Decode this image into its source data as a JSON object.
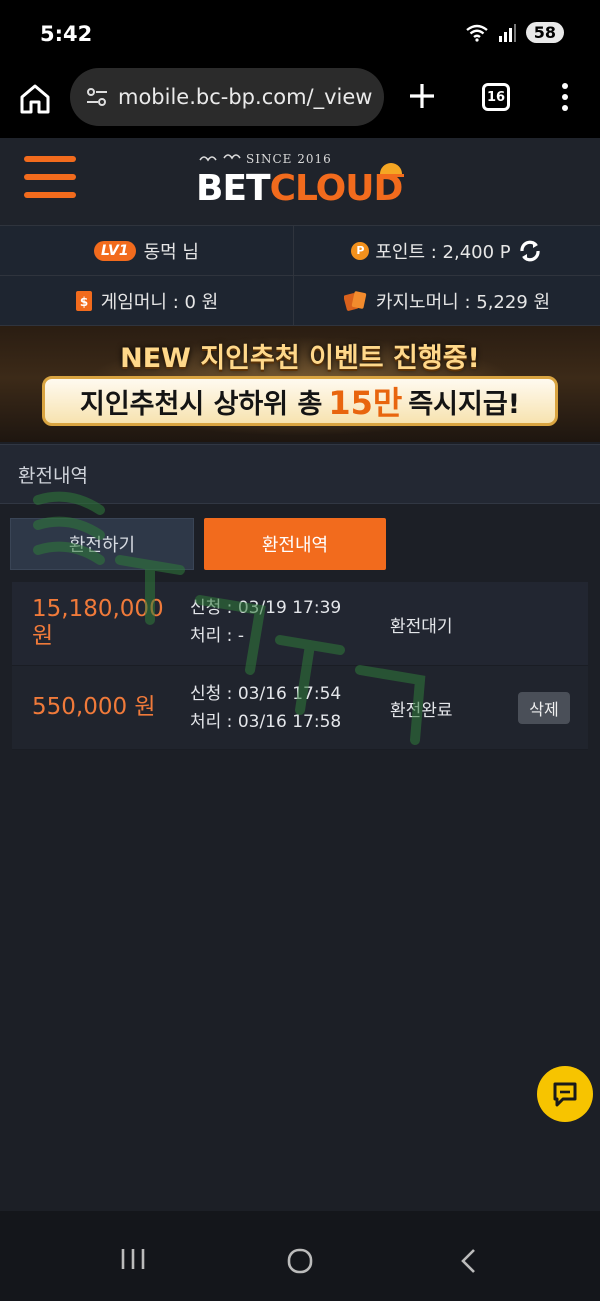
{
  "status": {
    "time": "5:42",
    "battery": "58"
  },
  "browser": {
    "url": "mobile.bc-bp.com/_view",
    "tab_count": "16"
  },
  "header": {
    "logo_since": "SINCE 2016",
    "logo_bet": "BET",
    "logo_cloud": "CLOUD"
  },
  "user": {
    "level": "LV1",
    "name": "동먹 님",
    "points": "포인트 : 2,400 P",
    "game_money": "게임머니 : 0 원",
    "casino_money": "카지노머니 : 5,229 원"
  },
  "banner": {
    "line1": "NEW 지인추천 이벤트 진행중!",
    "line2_pre": "지인추천시 상하위 총",
    "line2_highlight": "15만",
    "line2_post": "즉시지급!"
  },
  "section_title": "환전내역",
  "tabs": {
    "exchange": "환전하기",
    "history": "환전내역"
  },
  "records": [
    {
      "amount": "15,180,000 원",
      "request": "신청 : 03/19 17:39",
      "processed": "처리 : -",
      "status": "환전대기"
    },
    {
      "amount": "550,000 원",
      "request": "신청 : 03/16 17:54",
      "processed": "처리 : 03/16 17:58",
      "status": "환전완료",
      "delete_label": "삭제"
    }
  ],
  "colors": {
    "accent": "#f26b1d",
    "background": "#1c1f26",
    "chat": "#f7c400"
  },
  "icons": [
    "home-icon",
    "site-settings-icon",
    "plus-icon",
    "tabs-icon",
    "more-vert-icon",
    "hamburger-menu-icon",
    "point-coin-icon",
    "refresh-icon",
    "wallet-icon",
    "cards-icon",
    "chat-icon",
    "recents-icon",
    "home-nav-icon",
    "back-icon"
  ]
}
